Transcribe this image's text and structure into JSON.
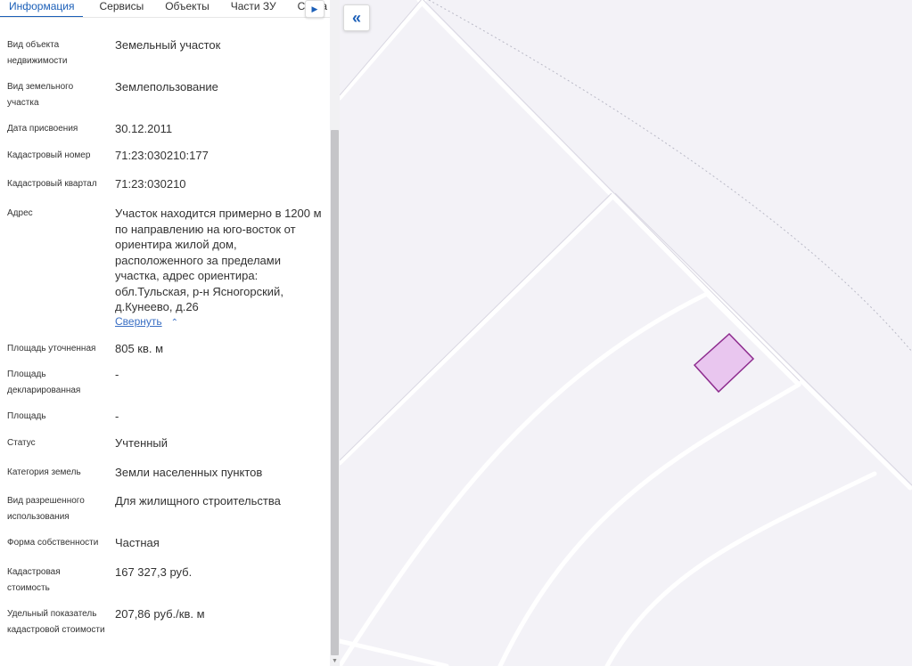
{
  "tabs": {
    "items": [
      {
        "label": "Информация"
      },
      {
        "label": "Сервисы"
      },
      {
        "label": "Объекты"
      },
      {
        "label": "Части ЗУ"
      },
      {
        "label": "Соста"
      }
    ],
    "next_icon": "triangle-right-icon"
  },
  "info": {
    "fields": [
      {
        "label": "Вид объекта недвижимости",
        "value": "Земельный участок"
      },
      {
        "label": "Вид земельного участка",
        "value": "Землепользование"
      },
      {
        "label": "Дата присвоения",
        "value": "30.12.2011"
      },
      {
        "label": "Кадастровый номер",
        "value": "71:23:030210:177"
      },
      {
        "label": "Кадастровый квартал",
        "value": "71:23:030210"
      },
      {
        "label": "Адрес",
        "value": "Участок находится примерно в 1200 м по направлению на юго-восток от ориентира жилой дом, расположенного за пределами участка, адрес ориентира: обл.Тульская, р-н Ясногорский, д.Кунеево, д.26"
      },
      {
        "label": "Площадь уточненная",
        "value": "805 кв. м"
      },
      {
        "label": "Площадь декларированная",
        "value": "-"
      },
      {
        "label": "Площадь",
        "value": "-"
      },
      {
        "label": "Статус",
        "value": "Учтенный"
      },
      {
        "label": "Категория земель",
        "value": "Земли населенных пунктов"
      },
      {
        "label": "Вид разрешенного использования",
        "value": "Для жилищного строительства"
      },
      {
        "label": "Форма собственности",
        "value": "Частная"
      },
      {
        "label": "Кадастровая стоимость",
        "value": "167 327,3 руб."
      },
      {
        "label": "Удельный показатель кадастровой стоимости",
        "value": "207,86 руб./кв. м"
      }
    ],
    "collapse_label": "Свернуть",
    "collapse_icon": "chevron-up-icon"
  },
  "map": {
    "collapse_panel_icon": "double-chevron-left-icon",
    "parcel_fill": "#e9c6ef",
    "parcel_stroke": "#8e2c8f"
  },
  "colors": {
    "accent": "#1b5fb8",
    "link": "#3a6fc4",
    "map_background": "#f3f2f7"
  }
}
